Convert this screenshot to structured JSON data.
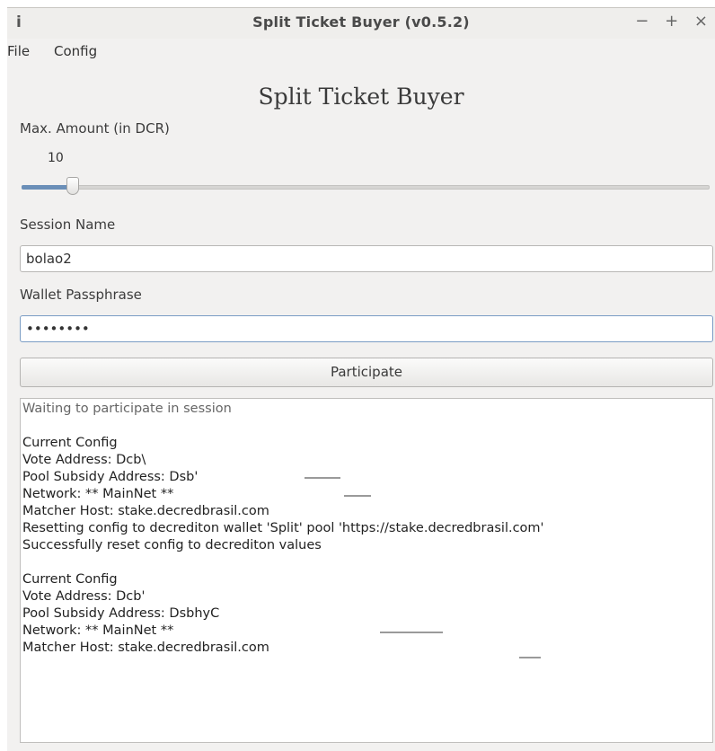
{
  "window": {
    "info_icon": "i",
    "title": "Split Ticket Buyer (v0.5.2)",
    "controls": [
      "−",
      "+",
      "×"
    ]
  },
  "menu": {
    "items": [
      "File",
      "Config"
    ]
  },
  "heading": "Split Ticket Buyer",
  "max_amount": {
    "label": "Max. Amount (in DCR)",
    "value": "10",
    "slider_fraction": 0.075
  },
  "session": {
    "label": "Session Name",
    "value": "bolao2"
  },
  "passphrase": {
    "label": "Wallet Passphrase",
    "value": "••••••••"
  },
  "participate_button": "Participate",
  "log": {
    "lines": [
      "Waiting to participate in session",
      "",
      "Current Config",
      "Vote Address: Dcb\\",
      "Pool Subsidy Address: Dsb'",
      "Network: ** MainNet **",
      "Matcher Host: stake.decredbrasil.com",
      "Resetting config to decrediton wallet 'Split' pool 'https://stake.decredbrasil.com'",
      "Successfully reset config to decrediton values",
      "",
      "Current Config",
      "Vote Address: Dcb'",
      "Pool Subsidy Address: DsbhyC",
      "Network: ** MainNet **",
      "Matcher Host: stake.decredbrasil.com"
    ]
  }
}
